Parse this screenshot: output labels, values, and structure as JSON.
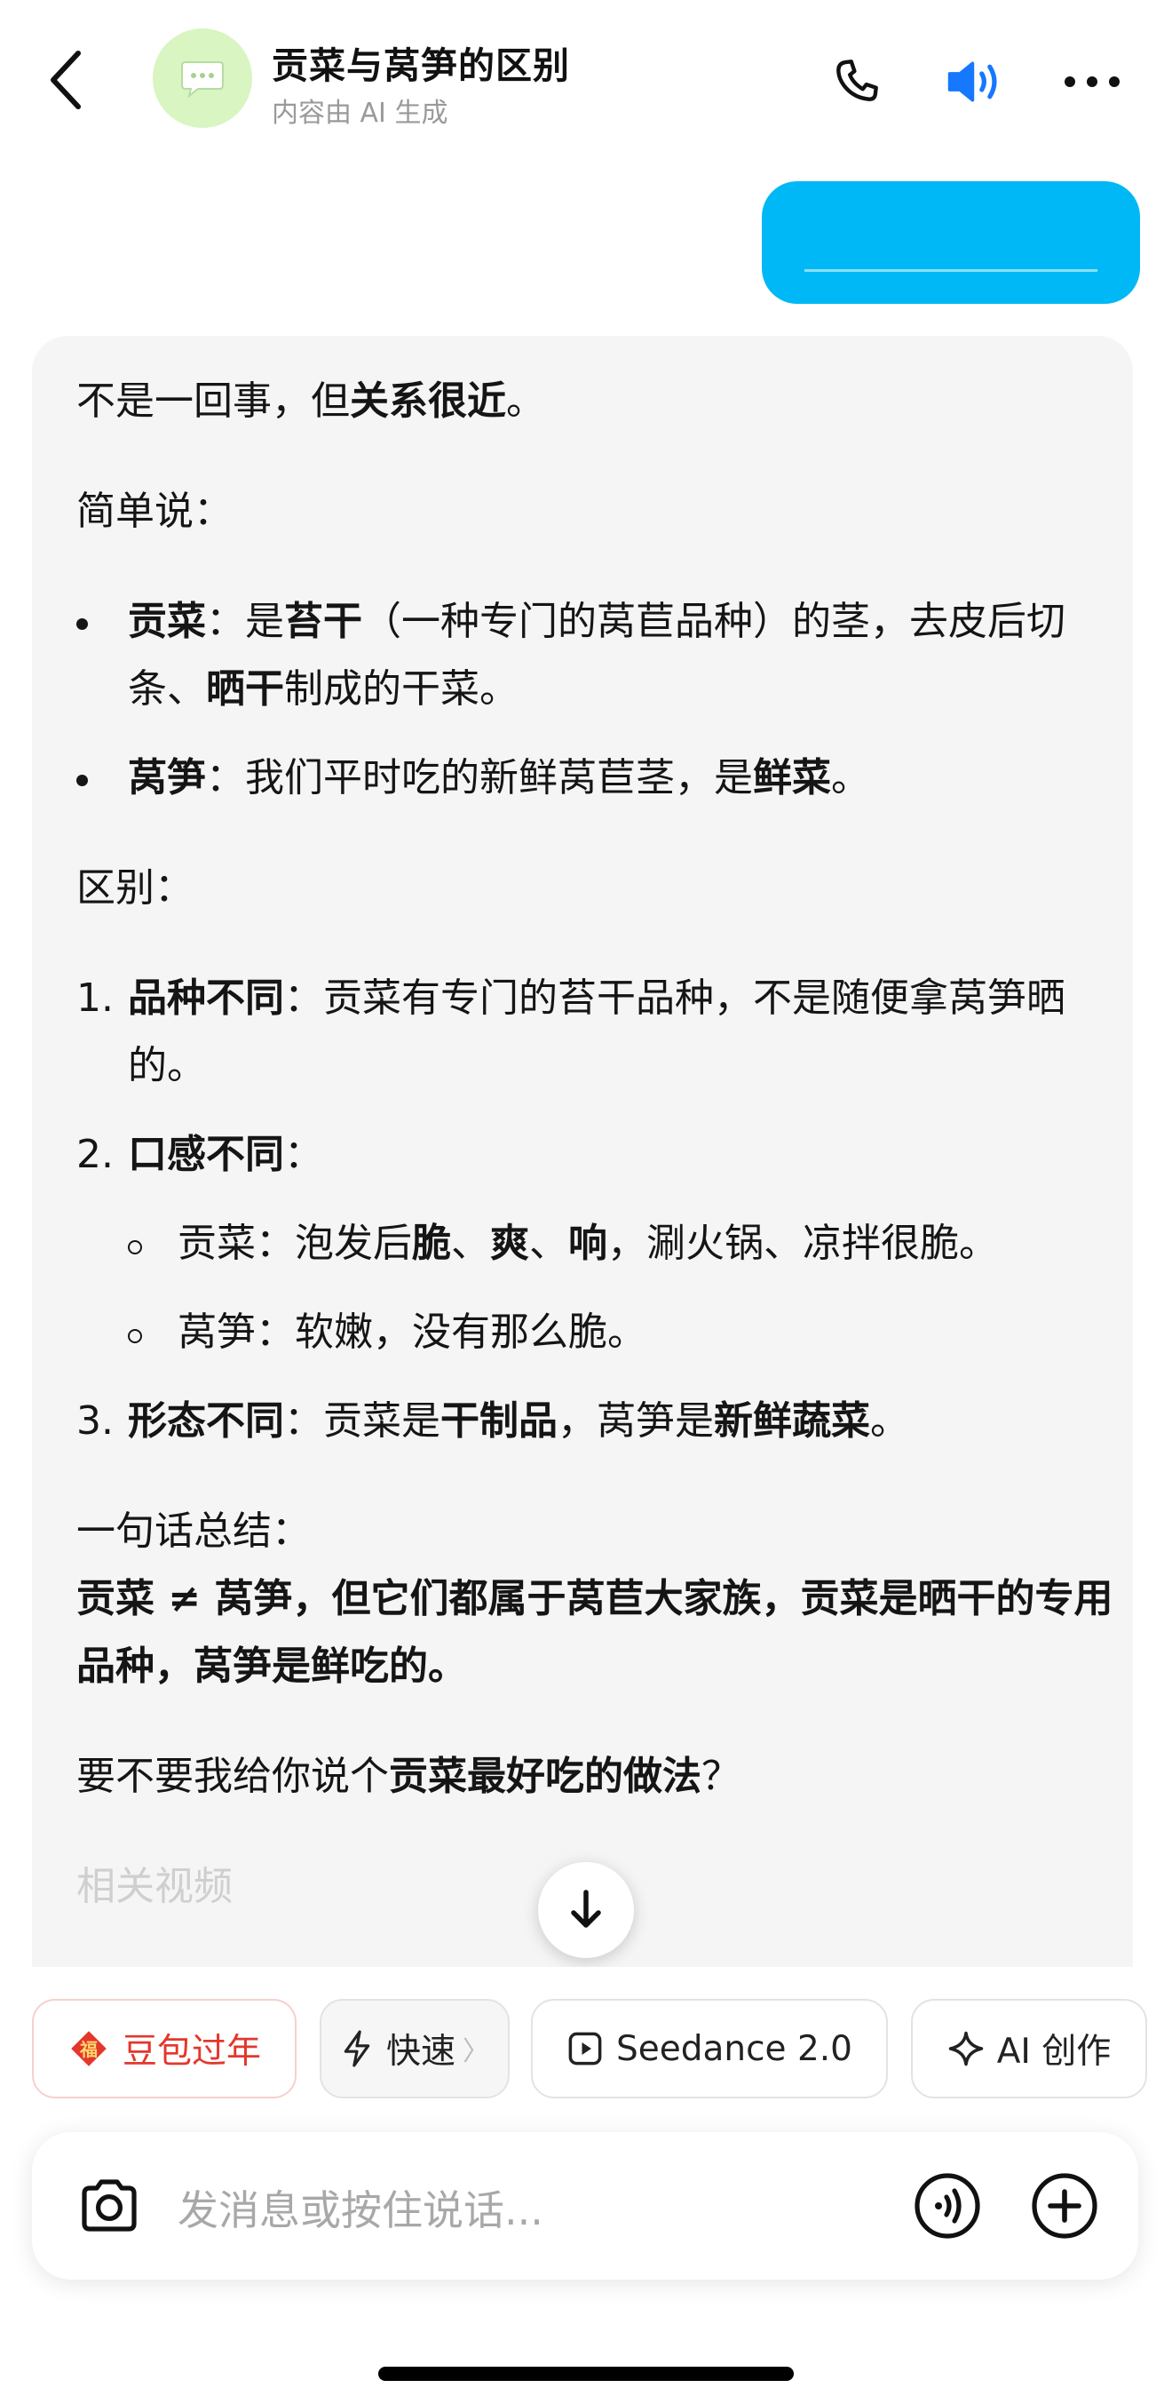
{
  "header": {
    "title": "贡菜与莴笋的区别",
    "subtitle": "内容由 AI 生成",
    "back_icon": "chevron-left-icon",
    "avatar_icon": "chat-bubble-icon",
    "phone_icon": "phone-icon",
    "speaker_icon": "speaker-icon",
    "more_icon": "more-dots-icon",
    "speaker_color": "#1677ff"
  },
  "user_message": {
    "bubble_color": "#00b8f5"
  },
  "reply": {
    "intro_a": "不是一回事，但",
    "intro_b": "关系很近",
    "intro_c": "。",
    "simple_heading": "简单说：",
    "bullets": [
      {
        "term": "贡菜",
        "a": "：是",
        "b": "苔干",
        "c": "（一种专门的莴苣品种）的茎，去皮后切条、",
        "d": "晒干",
        "e": "制成的干菜。"
      },
      {
        "term": "莴笋",
        "a": "：我们平时吃的新鲜莴苣茎，是",
        "b": "鲜菜",
        "c": "。"
      }
    ],
    "diff_heading": "区别：",
    "items": [
      {
        "num": "1.",
        "term": "品种不同",
        "text": "：贡菜有专门的苔干品种，不是随便拿莴笋晒的。"
      },
      {
        "num": "2.",
        "term": "口感不同",
        "text": "："
      },
      {
        "num": "3.",
        "term": "形态不同",
        "a": "：贡菜是",
        "b": "干制品",
        "c": "，莴笋是",
        "d": "新鲜蔬菜",
        "e": "。"
      }
    ],
    "sub_items": [
      {
        "a": "贡菜：泡发后",
        "b": "脆",
        "c": "、",
        "d": "爽",
        "e": "、",
        "f": "响",
        "g": "，涮火锅、凉拌很脆。"
      },
      {
        "a": "莴笋：软嫩，没有那么脆。"
      }
    ],
    "summary_heading": "一句话总结：",
    "summary_bold": "贡菜 ≠ 莴笋，但它们都属于莴苣大家族，贡菜是晒干的专用品种，莴笋是鲜吃的。",
    "question_a": "要不要我给你说个",
    "question_b": "贡菜最好吃的做法",
    "question_c": "？",
    "faded_next": "相关视频"
  },
  "scroll_icon": "arrow-down-icon",
  "chips": [
    {
      "label": "豆包过年",
      "icon": "fu-badge-icon",
      "color": "#e3372c"
    },
    {
      "label": "快速",
      "icon": "lightning-icon",
      "suffix": "〉"
    },
    {
      "label": "Seedance 2.0",
      "icon": "play-square-icon"
    },
    {
      "label": "AI 创作",
      "icon": "sparkle-icon"
    }
  ],
  "input": {
    "placeholder": "发消息或按住说话...",
    "camera_icon": "camera-icon",
    "voice_icon": "voice-wave-icon",
    "plus_icon": "plus-circle-icon"
  }
}
